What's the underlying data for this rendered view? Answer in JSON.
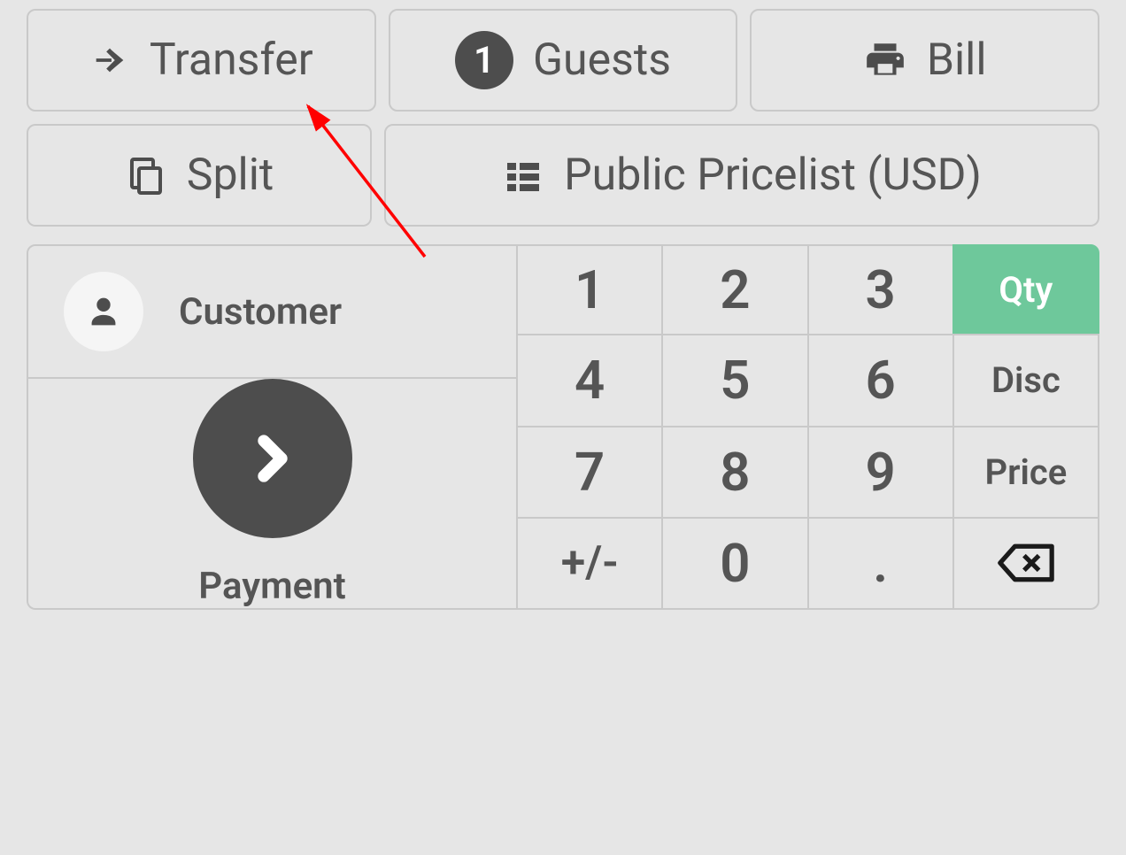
{
  "actions": {
    "transfer": "Transfer",
    "guests": "Guests",
    "guests_count": "1",
    "bill": "Bill",
    "split": "Split",
    "pricelist": "Public Pricelist (USD)"
  },
  "customer": {
    "label": "Customer"
  },
  "payment": {
    "label": "Payment"
  },
  "numpad": {
    "k1": "1",
    "k2": "2",
    "k3": "3",
    "k4": "4",
    "k5": "5",
    "k6": "6",
    "k7": "7",
    "k8": "8",
    "k9": "9",
    "sign": "+/-",
    "k0": "0",
    "dot": ".",
    "mode_qty": "Qty",
    "mode_disc": "Disc",
    "mode_price": "Price"
  },
  "colors": {
    "accent": "#6ec89b",
    "dark": "#4d4d4d",
    "text": "#555555",
    "border": "#c9c9c9",
    "bg": "#e6e6e6"
  }
}
